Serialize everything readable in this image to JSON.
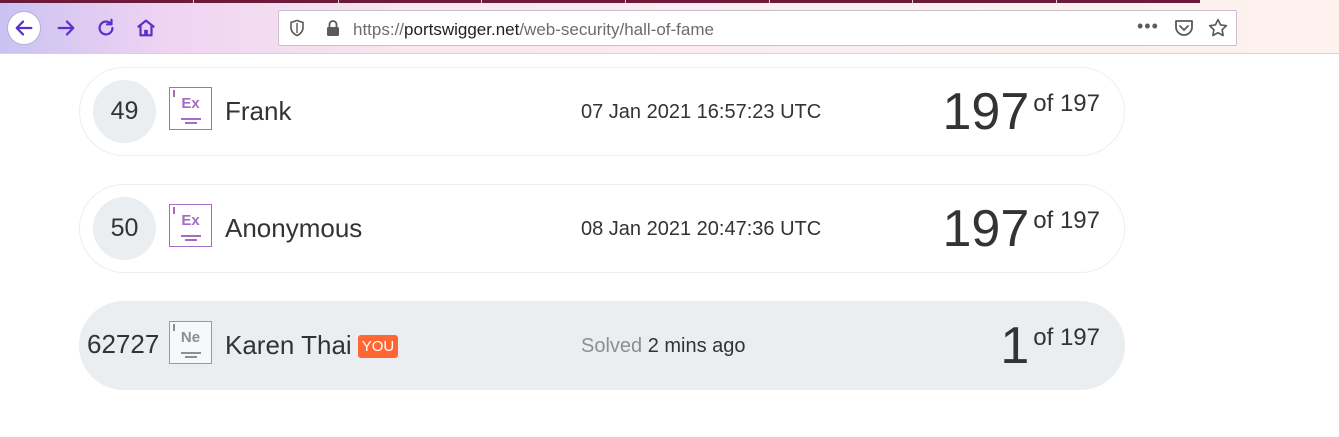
{
  "browser": {
    "url_scheme": "https://",
    "url_host": "portswigger.net",
    "url_path": "/web-security/hall-of-fame",
    "more_label": "•••",
    "icons": [
      "back-arrow-icon",
      "forward-arrow-icon",
      "reload-icon",
      "home-icon",
      "shield-icon",
      "lock-icon",
      "pocket-icon",
      "star-icon"
    ],
    "accent_color": "#5b2fcf"
  },
  "leaderboard": {
    "rows": [
      {
        "rank": "49",
        "badge": "Ex",
        "name": "Frank",
        "date": "07 Jan 2021 16:57:23 UTC",
        "score": "197",
        "of": "of 197"
      },
      {
        "rank": "50",
        "badge": "Ex",
        "name": "Anonymous",
        "date": "08 Jan 2021 20:47:36 UTC",
        "score": "197",
        "of": "of 197"
      }
    ],
    "me": {
      "rank": "62727",
      "badge": "Ne",
      "name": "Karen Thai",
      "you_tag": "YOU",
      "solved_label": "Solved",
      "solved_time": "2 mins ago",
      "score": "1",
      "of": "of 197"
    },
    "colors": {
      "expert_badge": "#a56cc1",
      "novice_badge": "#8e8e8e",
      "you_tag": "#ff6633",
      "highlight_row": "#eaeef0"
    }
  }
}
